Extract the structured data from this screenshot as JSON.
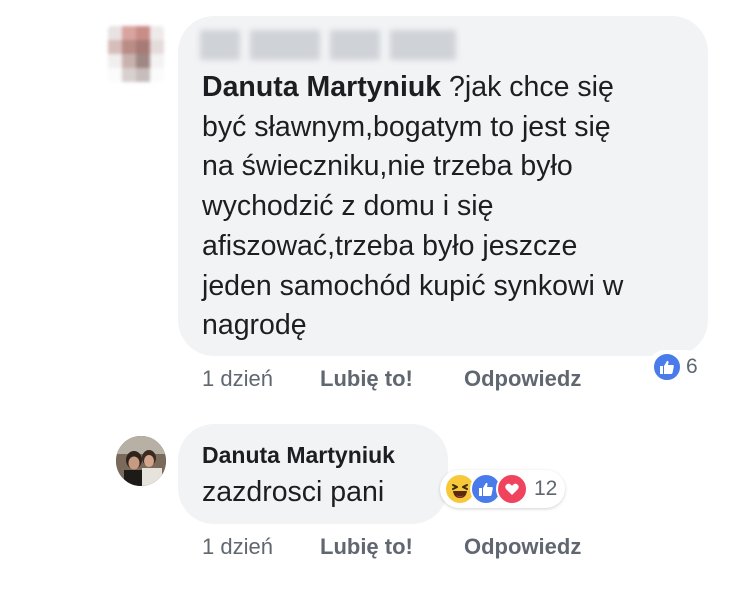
{
  "comments": [
    {
      "author": "Danuta Martyniuk",
      "text": "?jak chce się\nbyć sławnym,bogatym to jest się\nna świeczniku,nie trzeba było\nwychodzić z domu i się\nafiszować,trzeba było jeszcze\njeden samochód kupić synkowi w\nnagrodę",
      "reactions": {
        "icons": [
          "like-icon"
        ],
        "count": "6"
      },
      "actions": {
        "time": "1 dzień",
        "like": "Lubię to!",
        "reply": "Odpowiedz"
      }
    },
    {
      "author": "Danuta Martyniuk",
      "text": "zazdrosci pani",
      "reactions": {
        "icons": [
          "haha-icon",
          "like-icon",
          "love-icon"
        ],
        "count": "12"
      },
      "actions": {
        "time": "1 dzień",
        "like": "Lubię to!",
        "reply": "Odpowiedz"
      }
    }
  ],
  "colors": {
    "bubble": "#f2f3f5",
    "meta_text": "#606770",
    "like_blue": "#4a7bea",
    "love_red": "#f0445e",
    "haha_yellow": "#f7c83a"
  }
}
